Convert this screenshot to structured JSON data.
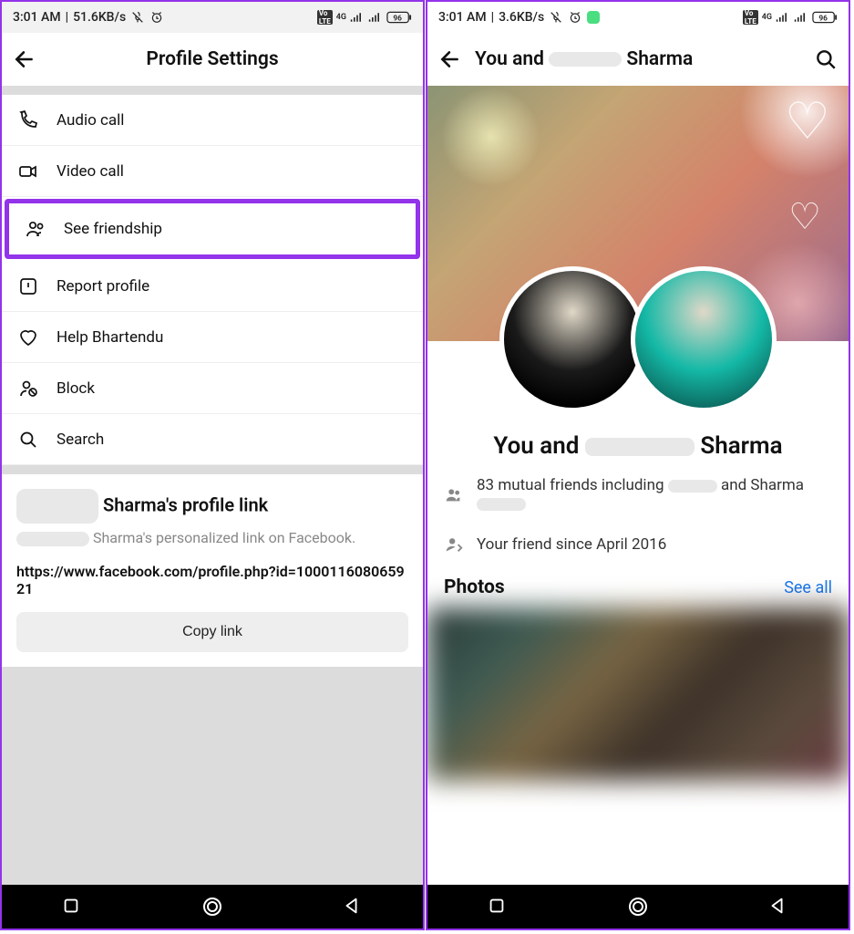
{
  "left": {
    "status": {
      "time": "3:01 AM",
      "speed": "51.6KB/s",
      "battery": "96",
      "net": "4G"
    },
    "header": {
      "title": "Profile Settings"
    },
    "menu": [
      {
        "icon": "phone-icon",
        "label": "Audio call"
      },
      {
        "icon": "video-icon",
        "label": "Video call"
      },
      {
        "icon": "friendship-icon",
        "label": "See friendship",
        "highlighted": true
      },
      {
        "icon": "report-icon",
        "label": "Report profile"
      },
      {
        "icon": "heart-icon",
        "label": "Help Bhartendu"
      },
      {
        "icon": "block-icon",
        "label": "Block"
      },
      {
        "icon": "search-icon",
        "label": "Search"
      }
    ],
    "profile_link": {
      "title_suffix": "Sharma's profile link",
      "subtitle_suffix": "Sharma's personalized link on Facebook.",
      "url": "https://www.facebook.com/profile.php?id=100011608065921",
      "copy_label": "Copy link"
    }
  },
  "right": {
    "status": {
      "time": "3:01 AM",
      "speed": "3.6KB/s",
      "battery": "96",
      "net": "4G"
    },
    "header": {
      "title_prefix": "You and",
      "title_suffix": "Sharma"
    },
    "friendship": {
      "title_prefix": "You and",
      "title_suffix": "Sharma",
      "mutual_prefix": "83 mutual friends including",
      "mutual_suffix": "and Sharma",
      "since": "Your friend since April 2016"
    },
    "photos": {
      "label": "Photos",
      "see_all": "See all"
    }
  }
}
